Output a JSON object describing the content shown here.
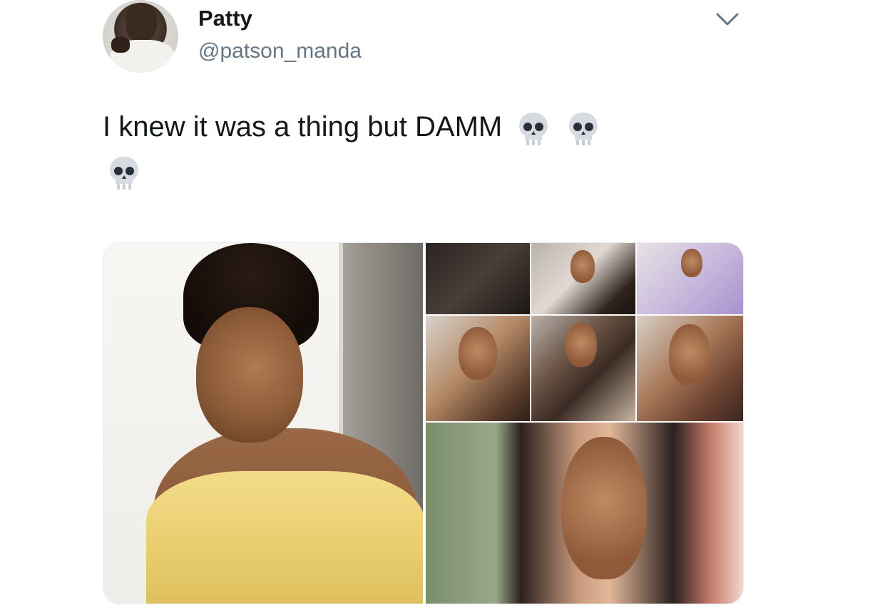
{
  "tweet": {
    "display_name": "Patty",
    "handle": "@patson_manda",
    "text": "I knew it was a thing but DAMM",
    "emoji": [
      "skull-emoji",
      "skull-emoji",
      "skull-emoji"
    ]
  },
  "media": {
    "layout": "one-large-left, grid-right",
    "tiles": [
      {
        "name": "photo-large-left"
      },
      {
        "name": "thumb-1"
      },
      {
        "name": "thumb-2"
      },
      {
        "name": "thumb-3"
      },
      {
        "name": "thumb-4"
      },
      {
        "name": "thumb-5"
      },
      {
        "name": "thumb-6"
      },
      {
        "name": "photo-bottom-right"
      }
    ]
  },
  "colors": {
    "text_primary": "#14171a",
    "text_secondary": "#657786",
    "chevron": "#657786",
    "background": "#ffffff"
  }
}
